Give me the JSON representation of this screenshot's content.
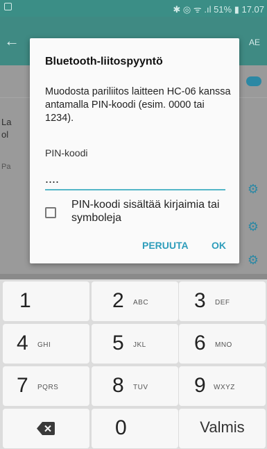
{
  "status_bar": {
    "right_text": "✱ ◎ ᯤ .ıl 51% ▮ 17.07"
  },
  "background": {
    "app_action": "AE",
    "text_line1": "La",
    "text_line2": "ol",
    "text_line3": "Pa"
  },
  "dialog": {
    "title": "Bluetooth-liitospyyntö",
    "message": "Muodosta pariliitos laitteen HC-06 kanssa antamalla PIN-koodi (esim. 0000 tai 1234).",
    "pin_label": "PIN-koodi",
    "pin_value": "....",
    "checkbox_label": "PIN-koodi sisältää kirjaimia tai symboleja",
    "checkbox_checked": false,
    "cancel_label": "PERUUTA",
    "ok_label": "OK",
    "accent_color": "#2e9dbb"
  },
  "keypad": {
    "keys": [
      {
        "num": "1",
        "sub": ""
      },
      {
        "num": "2",
        "sub": "ABC"
      },
      {
        "num": "3",
        "sub": "DEF"
      },
      {
        "num": "4",
        "sub": "GHI"
      },
      {
        "num": "5",
        "sub": "JKL"
      },
      {
        "num": "6",
        "sub": "MNO"
      },
      {
        "num": "7",
        "sub": "PQRS"
      },
      {
        "num": "8",
        "sub": "TUV"
      },
      {
        "num": "9",
        "sub": "WXYZ"
      }
    ],
    "zero": "0",
    "done_label": "Valmis",
    "backspace_icon": "backspace-icon"
  }
}
